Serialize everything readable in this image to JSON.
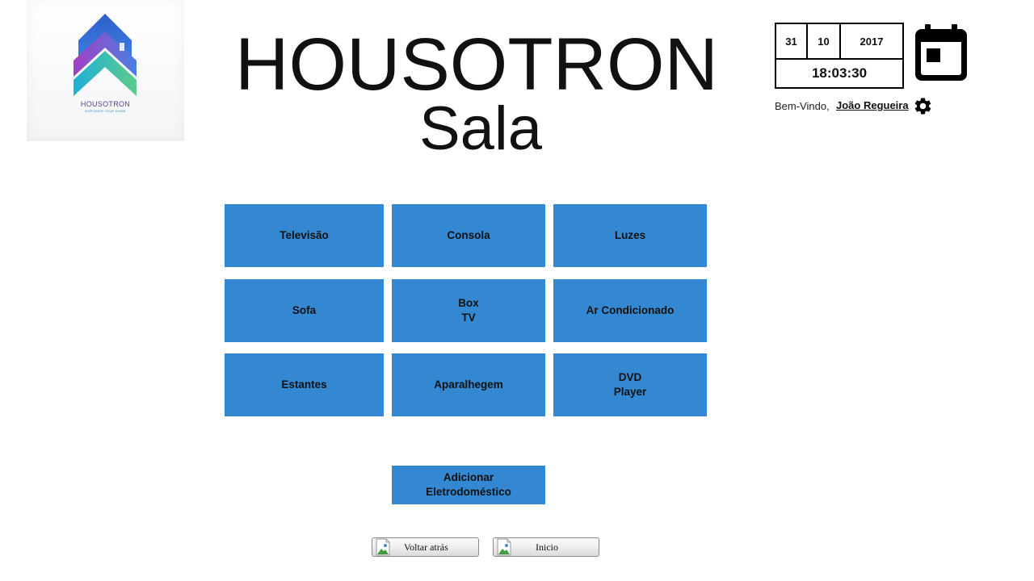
{
  "app": {
    "title": "HOUSOTRON",
    "room": "Sala"
  },
  "logo": {
    "wordmark": "HOUSOTRON",
    "tagline": "EMPOWER YOUR HOME"
  },
  "datetime": {
    "day": "31",
    "month": "10",
    "year": "2017",
    "time": "18:03:30"
  },
  "user": {
    "greeting": "Bem-Vindo,",
    "name": "João Regueira"
  },
  "icons": {
    "calendar": "calendar-icon",
    "settings": "gear-icon",
    "broken_image": "broken-image-icon"
  },
  "colors": {
    "tile": "#3488d1",
    "text": "#111111",
    "background": "#ffffff"
  },
  "devices": [
    {
      "label": "Televisão"
    },
    {
      "label": "Consola"
    },
    {
      "label": "Luzes"
    },
    {
      "label": "Sofa"
    },
    {
      "label": "Box\nTV"
    },
    {
      "label": "Ar Condicionado"
    },
    {
      "label": "Estantes"
    },
    {
      "label": "Aparalhegem"
    },
    {
      "label": "DVD\nPlayer"
    }
  ],
  "add_device": {
    "label": "Adicionar\nEletrodoméstico"
  },
  "nav": {
    "back": "Voltar atrás",
    "home": "Inicio"
  }
}
